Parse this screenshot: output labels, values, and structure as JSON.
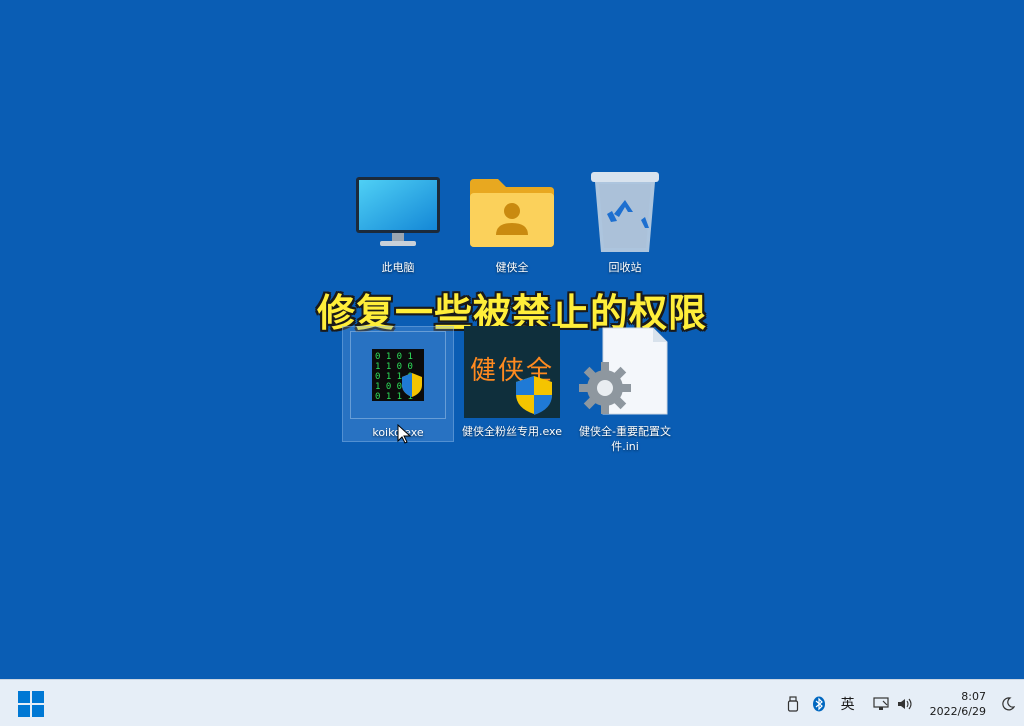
{
  "desktop": {
    "caption": "修复一些被禁止的权限",
    "icons": [
      {
        "label": "此电脑",
        "icon": "monitor-icon"
      },
      {
        "label": "健侠全",
        "icon": "user-folder-icon"
      },
      {
        "label": "回收站",
        "icon": "recycle-bin-icon"
      },
      {
        "label": "koiko.exe",
        "icon": "binary-shield-icon",
        "selected": true
      },
      {
        "label": "健侠全粉丝专用.exe",
        "icon": "app-shield-icon",
        "icon_text": "健侠全"
      },
      {
        "label": "健侠全-重要配置文件.ini",
        "icon": "settings-file-icon"
      }
    ]
  },
  "taskbar": {
    "start_icon": "windows-logo-icon",
    "tray": {
      "usb_icon": "usb-drive-icon",
      "bluetooth_icon": "bluetooth-icon",
      "input_method": "英",
      "network_icon": "network-icon",
      "volume_icon": "volume-icon",
      "time": "8:07",
      "date": "2022/6/29",
      "focus_icon": "moon-icon"
    }
  },
  "colors": {
    "desktop": "#0a5db4",
    "caption": "#ffee3a",
    "taskbar": "#e6eef7",
    "windows_logo": "#0078d4"
  }
}
